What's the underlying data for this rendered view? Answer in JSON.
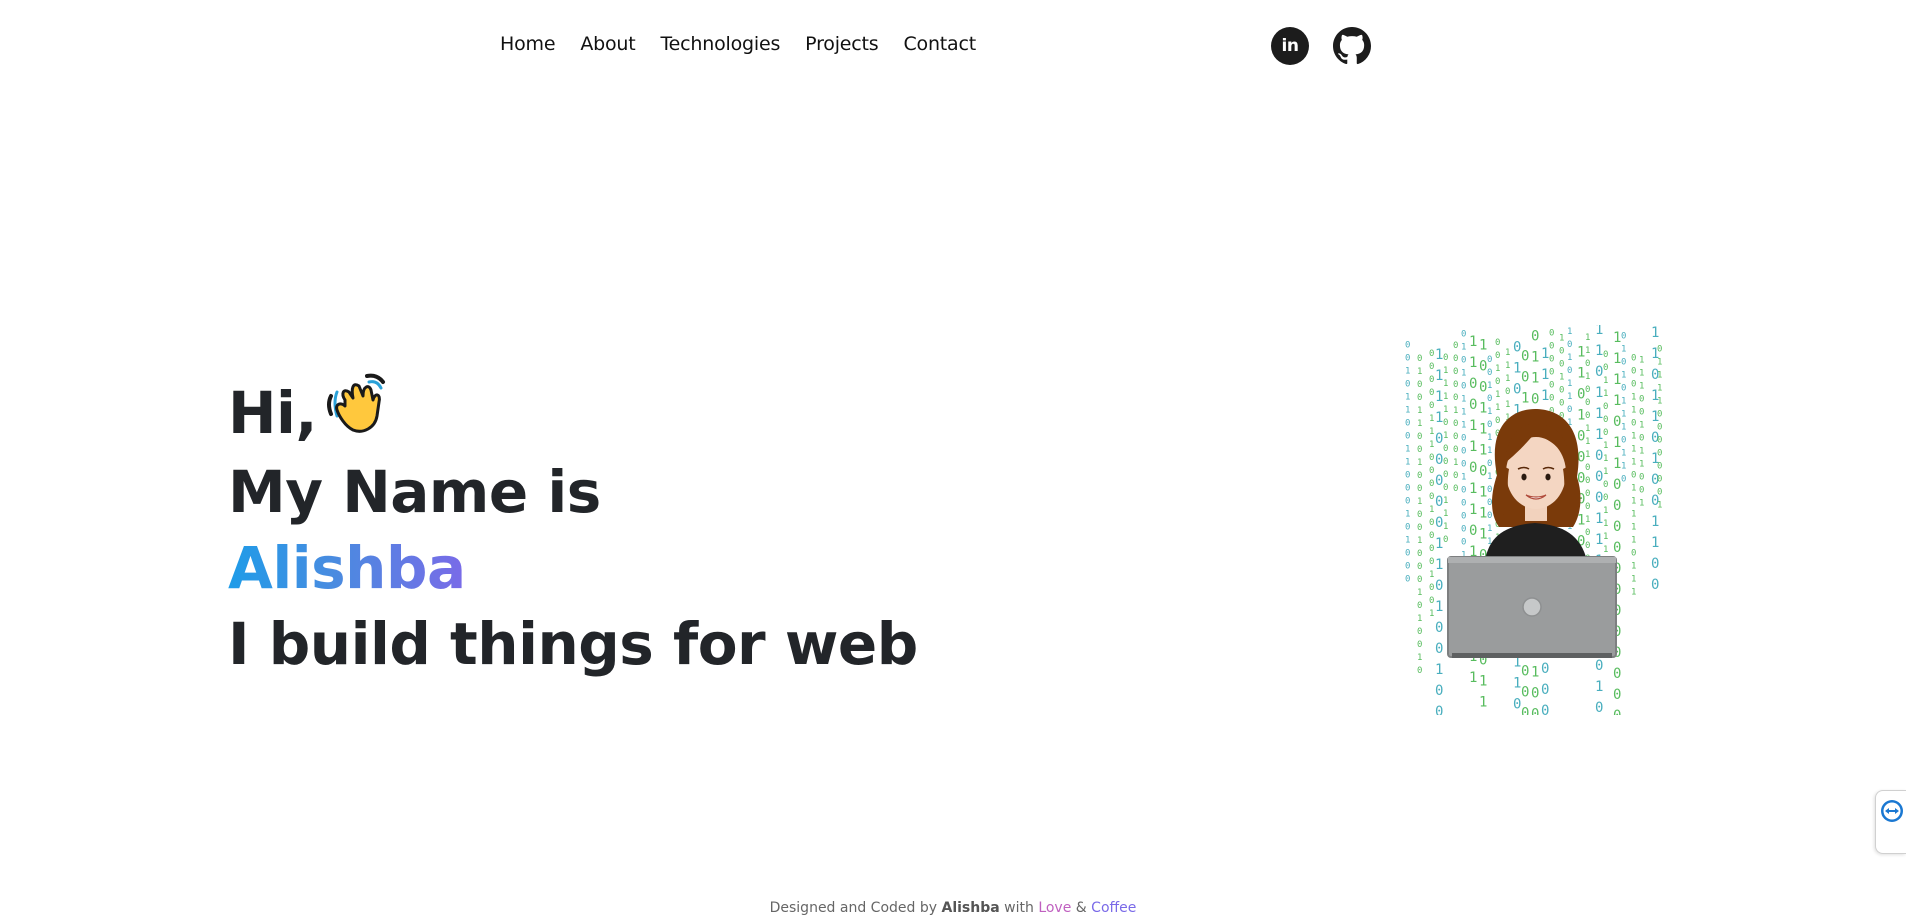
{
  "nav": {
    "links": [
      "Home",
      "About",
      "Technologies",
      "Projects",
      "Contact"
    ]
  },
  "social": {
    "linkedin_label": "in",
    "linkedin_icon": "linkedin-icon",
    "github_icon": "github-icon"
  },
  "hero": {
    "greeting": "Hi,",
    "wave_icon": "waving-hand-icon",
    "intro": "My Name is",
    "name": "Alishba",
    "tagline": "I build things for web"
  },
  "illustration": {
    "description_icon": "developer-with-laptop-illustration"
  },
  "footer": {
    "prefix": "Designed and Coded by",
    "author": "Alishba",
    "with": "with",
    "love": "Love",
    "amp": "&",
    "coffee": "Coffee"
  },
  "colors": {
    "name_gradient_start": "#1e9ce8",
    "name_gradient_end": "#7a6ae8",
    "binary_green": "#3bb143",
    "binary_teal": "#2aa1b3",
    "hair": "#7a3a0a",
    "laptop": "#9a9c9d"
  },
  "side_tab": {
    "icon": "teamviewer-icon"
  }
}
